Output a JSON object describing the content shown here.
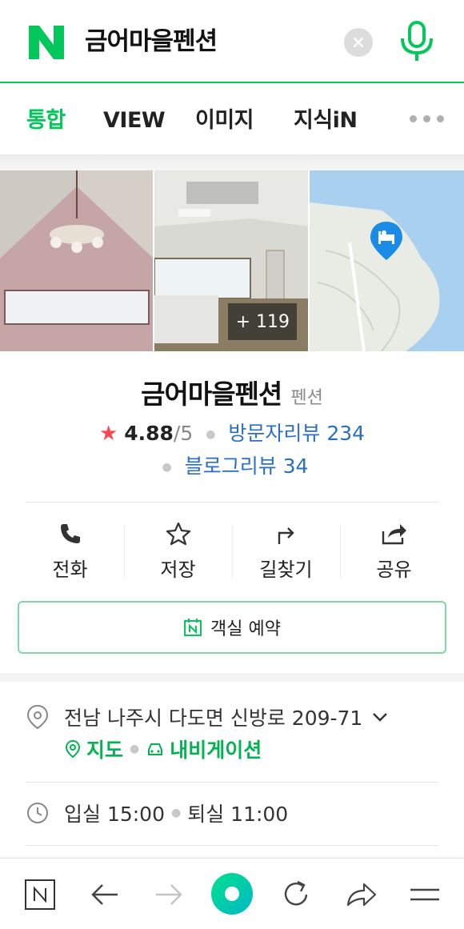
{
  "search": {
    "query": "금어마을펜션"
  },
  "tabs": [
    {
      "label": "통합",
      "active": true
    },
    {
      "label": "VIEW",
      "active": false
    },
    {
      "label": "이미지",
      "active": false
    },
    {
      "label": "지식iN",
      "active": false
    }
  ],
  "photos": {
    "more_count": "+ 119"
  },
  "place": {
    "name": "금어마을펜션",
    "category": "펜션",
    "rating": "4.88",
    "rating_max": "/5",
    "visitor_reviews": "방문자리뷰 234",
    "blog_reviews": "블로그리뷰 34"
  },
  "actions": [
    {
      "label": "전화",
      "icon": "phone-icon"
    },
    {
      "label": "저장",
      "icon": "star-outline-icon"
    },
    {
      "label": "길찾기",
      "icon": "directions-icon"
    },
    {
      "label": "공유",
      "icon": "share-icon"
    }
  ],
  "booking": {
    "label": "객실 예약",
    "icon": "naver-booking-icon"
  },
  "info": {
    "address": "전남 나주시 다도면 신방로 209-71",
    "map_link": "지도",
    "navigation_link": "내비게이션",
    "checkin": "입실 15:00",
    "checkout": "퇴실 11:00"
  },
  "colors": {
    "brand_green": "#03c75a",
    "link_blue": "#2a6ec6",
    "star_red": "#f44b55"
  }
}
